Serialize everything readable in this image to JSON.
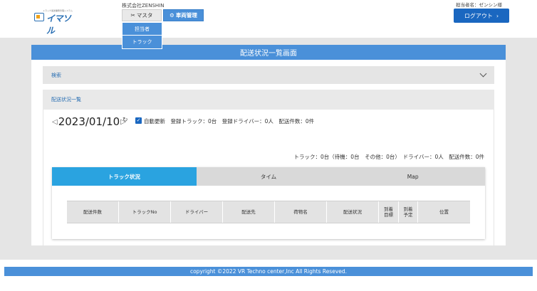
{
  "header": {
    "logo_small_text": "トラック運送業務管理システム",
    "logo_text": "イマソル",
    "company": "株式会社ZENSHIN",
    "nav_master_label": "マスタ",
    "nav_vehicle_label": "車両管理",
    "dropdown_items": [
      "担当者",
      "トラック"
    ],
    "user_label": "担当者名：ゼンシン様",
    "logout_label": "ログアウト",
    "logout_icon": "›"
  },
  "page": {
    "title": "配送状況一覧画面",
    "search_label": "検索",
    "list_label": "配送状況一覧"
  },
  "status": {
    "prev_arrow": "◁",
    "date": "2023/01/10",
    "next_arrow": "▷",
    "refresh_icon": "↻",
    "auto_update_checked": true,
    "status_text": "自動更新　登録トラック：0台　登録ドライバー：0人　配送件数：0件"
  },
  "summary": "トラック：0台（待機：0台　その他：0台）　ドライバー：0人　配送件数：0件",
  "tabs": [
    {
      "label": "トラック状況",
      "active": true
    },
    {
      "label": "タイム",
      "active": false
    },
    {
      "label": "Map",
      "active": false
    }
  ],
  "table": {
    "columns": [
      "配送件数",
      "トラックNo",
      "ドライバー",
      "配送先",
      "荷物名",
      "配送状況",
      "到着\n目標",
      "到着\n予定",
      "位置"
    ]
  },
  "footer": "copyright ©2022 VR Techno center,Inc All Rights Reseved.",
  "colors": {
    "primary_blue": "#4a90d9",
    "dark_blue": "#1a67c0",
    "tab_active": "#2aa3e0",
    "band_gray": "#e5e5e5"
  }
}
